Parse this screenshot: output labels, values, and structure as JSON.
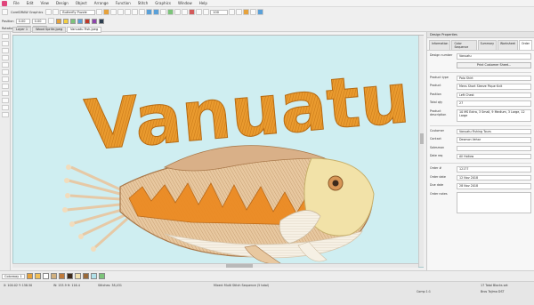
{
  "app": {
    "title": "CorelDRAW Graphics"
  },
  "menu": [
    "File",
    "Edit",
    "View",
    "Design",
    "Object",
    "Arrange",
    "Function",
    "Stitch",
    "Graphics",
    "Window",
    "Help"
  ],
  "toolbar": {
    "open_file_label": "Butterfly Puzzle",
    "zoom_value": "100",
    "position": {
      "x_label": "Position",
      "x_value": "0.00",
      "y_label": "Rotation",
      "y_value": "0.00",
      "w_value": "0.00",
      "h_value": "0.00"
    },
    "colors": [
      "#e6a23c",
      "#f4d03f",
      "#7cc47a",
      "#5aa0d8",
      "#c0392b",
      "#8e44ad",
      "#2c3e50"
    ]
  },
  "doc_tabs": [
    "Layer 1",
    "Wood Sprite.jpeg",
    "Vanuatu Fish.jpeg"
  ],
  "design": {
    "title_text": "Vanuatu"
  },
  "panel": {
    "title": "Design Properties",
    "tabs": [
      "Information",
      "Color Sequence",
      "Summary",
      "Worksheet",
      "Order"
    ],
    "design_number_label": "Design number",
    "design_number_value": "Vanuatu",
    "import_button": "Print Customer Sheet...",
    "rows": [
      {
        "label": "Product type",
        "value": "Polo Shirt"
      },
      {
        "label": "Product",
        "value": "Mens Short Sleeve Pique Knit"
      },
      {
        "label": "Position",
        "value": "Left Chest"
      },
      {
        "label": "Total qty",
        "value": "27"
      },
      {
        "label": "Product description",
        "value": "10 MS Extra, 3 Small, 9 Medium, 3 Large, 12 Large"
      }
    ],
    "rows2": [
      {
        "label": "Customer",
        "value": "Vanuatu Fishing Tours"
      },
      {
        "label": "Contact",
        "value": "Desmon Vehar"
      },
      {
        "label": "Salesman",
        "value": ""
      },
      {
        "label": "Date req",
        "value": "All Hollow"
      }
    ],
    "rows3": [
      {
        "label": "Order #",
        "value": "12177"
      },
      {
        "label": "Order date",
        "value": "12 Nov 2018"
      },
      {
        "label": "Due date",
        "value": "28 Nov 2018"
      },
      {
        "label": "Order notes",
        "value": ""
      }
    ]
  },
  "bottom": {
    "colorway_label": "Colorway 1",
    "colorway_swatches": [
      "#e6a23c",
      "#f0c05a",
      "#ffffff",
      "#d0b080",
      "#c07a3a",
      "#3d2a1c",
      "#f2e2b0",
      "#9a6a3a",
      "#b0e0e8",
      "#7cc47a"
    ]
  },
  "status": {
    "coords": "X: 100.02 Y: 158.50",
    "size": "W: 153.9 H: 116.4",
    "stitches": "Stitches: 38,431",
    "object": "Mixed: Multi Stitch Sequence (5 total)",
    "colors_info": "17 Total Blocks set",
    "zoom": "Comp 1:1",
    "machine": "Bros Tajima DST"
  }
}
